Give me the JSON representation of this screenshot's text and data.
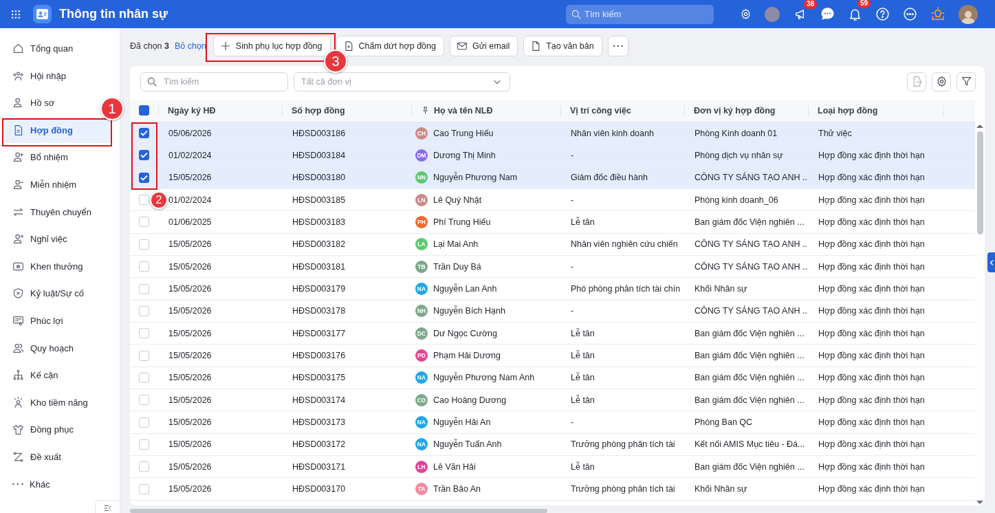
{
  "header": {
    "title": "Thông tin nhân sự",
    "search": {
      "placeholder": "Tìm kiếm"
    },
    "announcements_badge": "38",
    "notifications_badge": "59"
  },
  "sidebar": {
    "items": [
      {
        "label": "Tổng quan",
        "selected": false
      },
      {
        "label": "Hội nhập",
        "selected": false
      },
      {
        "label": "Hồ sơ",
        "selected": false
      },
      {
        "label": "Hợp đồng",
        "selected": true
      },
      {
        "label": "Bổ nhiệm",
        "selected": false
      },
      {
        "label": "Miễn nhiệm",
        "selected": false
      },
      {
        "label": "Thuyên chuyển",
        "selected": false
      },
      {
        "label": "Nghỉ việc",
        "selected": false
      },
      {
        "label": "Khen thưởng",
        "selected": false
      },
      {
        "label": "Kỷ luật/Sự cố",
        "selected": false
      },
      {
        "label": "Phúc lợi",
        "selected": false
      },
      {
        "label": "Quy hoạch",
        "selected": false
      },
      {
        "label": "Kế cận",
        "selected": false
      },
      {
        "label": "Kho tiềm năng",
        "selected": false
      },
      {
        "label": "Đồng phục",
        "selected": false
      },
      {
        "label": "Đề xuất",
        "selected": false
      },
      {
        "label": "Khác",
        "selected": false
      }
    ]
  },
  "toolbar": {
    "selection": "Đã chọn **3**",
    "clear_link": "Bỏ chọn",
    "buttons": [
      {
        "kind": "add",
        "label": "Sinh phụ lục hợp đồng"
      },
      {
        "kind": "terminate",
        "label": "Chấm dứt hợp đồng"
      },
      {
        "kind": "email",
        "label": "Gửi email"
      },
      {
        "kind": "document",
        "label": "Tạo văn bản"
      },
      {
        "kind": "more"
      }
    ]
  },
  "filters": {
    "search": {
      "placeholder": "Tìm kiếm"
    },
    "unit_select": {
      "placeholder": "Tất cả đơn vị"
    },
    "actions": [
      {
        "kind": "export",
        "disabled": true
      },
      {
        "kind": "settings",
        "disabled": false
      },
      {
        "kind": "filter",
        "disabled": false
      }
    ]
  },
  "table": {
    "header_checkbox": {
      "indeterminate": true
    },
    "columns": [
      {
        "label": "Ngày ký HĐ",
        "pinned": false
      },
      {
        "label": "Số hợp đồng",
        "pinned": false
      },
      {
        "label": "Họ và tên NLĐ",
        "pinned": true
      },
      {
        "label": "Vị trí công việc",
        "pinned": false
      },
      {
        "label": "Đơn vị ký hợp đồng",
        "pinned": false
      },
      {
        "label": "Loại hợp đồng",
        "pinned": false
      }
    ],
    "rows": [
      {
        "selected": true,
        "date": "05/06/2026",
        "number": "HĐSD003186",
        "initials": "CH",
        "color": "#c98a85",
        "name": "Cao Trung Hiếu",
        "position": "Nhân viên kinh doanh",
        "unit": "Phòng Kinh doanh 01",
        "type": "Thử việc"
      },
      {
        "selected": true,
        "date": "01/02/2024",
        "number": "HĐSD003184",
        "initials": "DM",
        "color": "#8b6cf0",
        "name": "Dương Thị Minh",
        "position": "-",
        "unit": "Phòng dịch vụ nhân sự",
        "type": "Hợp đồng xác định thời hạn"
      },
      {
        "selected": true,
        "date": "15/05/2026",
        "number": "HĐSD003180",
        "initials": "NN",
        "color": "#5cc971",
        "name": "Nguyễn Phương Nam",
        "position": "Giám đốc điều hành",
        "unit": "CÔNG TY SÁNG TẠO ANH ...",
        "type": "Hợp đồng xác định thời hạn"
      },
      {
        "selected": false,
        "date": "01/02/2024",
        "number": "HĐSD003185",
        "initials": "LN",
        "color": "#c98a85",
        "name": "Lê Quý Nhật",
        "position": "-",
        "unit": "Phòng kinh doanh_06",
        "type": "Hợp đồng xác định thời hạn"
      },
      {
        "selected": false,
        "date": "01/06/2025",
        "number": "HĐSD003183",
        "initials": "PH",
        "color": "#f5662d",
        "name": "Phí Trung Hiếu",
        "position": "Lễ tân",
        "unit": "Ban giám đốc Viện nghiên ...",
        "type": "Hợp đồng xác định thời hạn"
      },
      {
        "selected": false,
        "date": "15/05/2026",
        "number": "HĐSD003182",
        "initials": "LA",
        "color": "#5cc971",
        "name": "Lại Mai Anh",
        "position": "Nhân viên nghiên cứu chiến",
        "unit": "CÔNG TY SÁNG TẠO ANH ...",
        "type": "Hợp đồng xác định thời hạn"
      },
      {
        "selected": false,
        "date": "15/05/2026",
        "number": "HĐSD003181",
        "initials": "TB",
        "color": "#7fa88c",
        "name": "Trần Duy Bá",
        "position": "-",
        "unit": "CÔNG TY SÁNG TẠO ANH ...",
        "type": "Hợp đồng xác định thời hạn"
      },
      {
        "selected": false,
        "date": "15/05/2026",
        "number": "HĐSD003179",
        "initials": "NA",
        "color": "#1ea7e8",
        "name": "Nguyễn Lan Anh",
        "position": "Phó phòng phân tích tài chín",
        "unit": "Khối Nhân sự",
        "type": "Hợp đồng xác định thời hạn"
      },
      {
        "selected": false,
        "date": "15/05/2026",
        "number": "HĐSD003178",
        "initials": "NH",
        "color": "#7fa88c",
        "name": "Nguyễn Bích Hạnh",
        "position": "-",
        "unit": "CÔNG TY SÁNG TẠO ANH ...",
        "type": "Hợp đồng xác định thời hạn"
      },
      {
        "selected": false,
        "date": "15/05/2026",
        "number": "HĐSD003177",
        "initials": "DC",
        "color": "#7fa88c",
        "name": "Dư Ngọc Cường",
        "position": "Lễ tân",
        "unit": "Ban giám đốc Viện nghiên ...",
        "type": "Hợp đồng xác định thời hạn"
      },
      {
        "selected": false,
        "date": "15/05/2026",
        "number": "HĐSD003176",
        "initials": "PD",
        "color": "#e84393",
        "name": "Phạm Hải Dương",
        "position": "Lễ tân",
        "unit": "Ban giám đốc Viện nghiên ...",
        "type": "Hợp đồng xác định thời hạn"
      },
      {
        "selected": false,
        "date": "15/05/2026",
        "number": "HĐSD003175",
        "initials": "NA",
        "color": "#1ea7e8",
        "name": "Nguyễn Phương Nam Anh",
        "position": "Lễ tân",
        "unit": "Ban giám đốc Viện nghiên ...",
        "type": "Hợp đồng xác định thời hạn"
      },
      {
        "selected": false,
        "date": "15/05/2026",
        "number": "HĐSD003174",
        "initials": "CD",
        "color": "#7fa88c",
        "name": "Cao Hoàng Dương",
        "position": "Lễ tân",
        "unit": "Ban giám đốc Viện nghiên ...",
        "type": "Hợp đồng xác định thời hạn"
      },
      {
        "selected": false,
        "date": "15/05/2026",
        "number": "HĐSD003173",
        "initials": "NA",
        "color": "#1ea7e8",
        "name": "Nguyễn Hải An",
        "position": "-",
        "unit": "Phòng Ban QC",
        "type": "Hợp đồng xác định thời hạn"
      },
      {
        "selected": false,
        "date": "15/05/2026",
        "number": "HĐSD003172",
        "initials": "NA",
        "color": "#1ea7e8",
        "name": "Nguyễn Tuấn Anh",
        "position": "Trưởng phòng phân tích tài",
        "unit": "Kết nối AMIS Mục tiêu - Đá...",
        "type": "Hợp đồng xác định thời hạn"
      },
      {
        "selected": false,
        "date": "15/05/2026",
        "number": "HĐSD003171",
        "initials": "LH",
        "color": "#e8409a",
        "name": "Lê Văn Hải",
        "position": "Lễ tân",
        "unit": "Ban giám đốc Viện nghiên ...",
        "type": "Hợp đồng xác định thời hạn"
      },
      {
        "selected": false,
        "date": "15/05/2026",
        "number": "HĐSD003170",
        "initials": "TA",
        "color": "#f08aa0",
        "name": "Trần Bảo An",
        "position": "Trưởng phòng phân tích tài",
        "unit": "Khối Nhân sự",
        "type": "Hợp đồng xác định thời hạn"
      }
    ]
  },
  "callouts": [
    {
      "number": "1"
    },
    {
      "number": "2"
    },
    {
      "number": "3"
    }
  ]
}
